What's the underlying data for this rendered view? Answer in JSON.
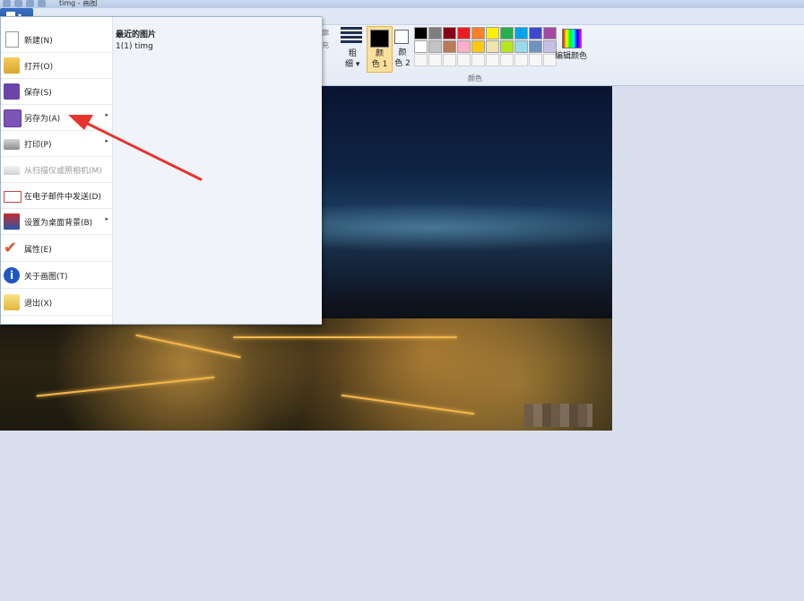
{
  "window": {
    "title": "timg - 画图"
  },
  "ribbon": {
    "fill_label_partial": "充",
    "outline_label_partial": "廓",
    "thickness_label": "粗\n细",
    "color1_label": "颜\n色 1",
    "color2_label": "颜\n色 2",
    "edit_colors_label": "编辑颜色",
    "group_label": "颜色",
    "palette": [
      "#000000",
      "#7f7f7f",
      "#880015",
      "#ed1c24",
      "#ff7f27",
      "#fff200",
      "#22b14c",
      "#00a2e8",
      "#3f48cc",
      "#a349a4",
      "#ffffff",
      "#c3c3c3",
      "#b97a57",
      "#ffaec9",
      "#ffc90e",
      "#efe4b0",
      "#b5e61d",
      "#99d9ea",
      "#7092be",
      "#c8bfe7",
      "",
      "",
      "",
      "",
      "",
      "",
      "",
      "",
      "",
      ""
    ]
  },
  "file_menu": {
    "items": [
      {
        "label": "新建(N)",
        "icon": "new-file-icon",
        "submenu": false,
        "disabled": false
      },
      {
        "label": "打开(O)",
        "icon": "open-folder-icon",
        "submenu": false,
        "disabled": false
      },
      {
        "label": "保存(S)",
        "icon": "save-icon",
        "submenu": false,
        "disabled": false
      },
      {
        "label": "另存为(A)",
        "icon": "save-as-icon",
        "submenu": true,
        "disabled": false
      },
      {
        "label": "打印(P)",
        "icon": "printer-icon",
        "submenu": true,
        "disabled": false
      },
      {
        "label": "从扫描仪或照相机(M)",
        "icon": "scanner-icon",
        "submenu": false,
        "disabled": true
      },
      {
        "label": "在电子邮件中发送(D)",
        "icon": "email-icon",
        "submenu": false,
        "disabled": false
      },
      {
        "label": "设置为桌面背景(B)",
        "icon": "desktop-background-icon",
        "submenu": true,
        "disabled": false
      },
      {
        "label": "属性(E)",
        "icon": "properties-check-icon",
        "submenu": false,
        "disabled": false
      },
      {
        "label": "关于画图(T)",
        "icon": "info-icon",
        "submenu": false,
        "disabled": false
      },
      {
        "label": "退出(X)",
        "icon": "exit-icon",
        "submenu": false,
        "disabled": false
      }
    ],
    "recent_title": "最近的图片",
    "recent_items": [
      "1(1) timg"
    ]
  },
  "annotation": {
    "color": "#e8342c",
    "points_at": "另存为(A)"
  }
}
